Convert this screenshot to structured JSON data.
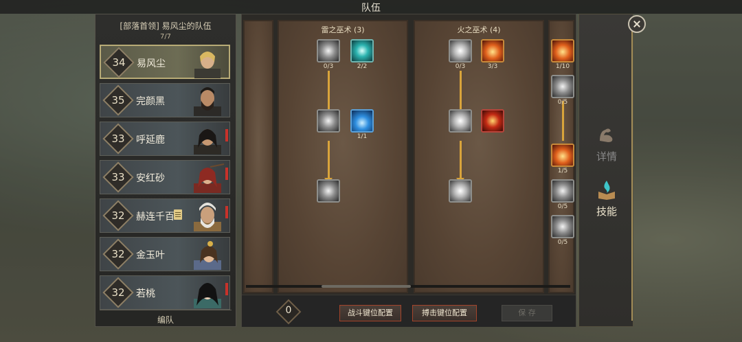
{
  "title": "队伍",
  "roster": {
    "title": "[部落首领] 易风尘的队伍",
    "count": "7/7",
    "members": [
      {
        "level": "34",
        "name": "易风尘"
      },
      {
        "level": "35",
        "name": "完颜黑"
      },
      {
        "level": "33",
        "name": "呼延鹿"
      },
      {
        "level": "33",
        "name": "安红砂"
      },
      {
        "level": "32",
        "name": "赫连千百"
      },
      {
        "level": "32",
        "name": "金玉叶"
      },
      {
        "level": "32",
        "name": "若桃"
      }
    ],
    "formation_label": "编队"
  },
  "skill_trees": {
    "thunder": {
      "label": "雷之巫术 (3)",
      "counts": [
        "0/3",
        "2/2",
        "1/1"
      ]
    },
    "fire": {
      "label": "火之巫术 (4)",
      "counts": [
        "0/3",
        "3/3"
      ]
    },
    "third": {
      "counts": [
        "1/10",
        "0/5",
        "1/5",
        "0/5",
        "0/5"
      ]
    }
  },
  "bottom": {
    "points": "0",
    "battle_key_config": "战斗键位配置",
    "capture_key_config": "搏击键位配置",
    "save": "保 存"
  },
  "tabs": {
    "details": "详情",
    "skills": "技能"
  },
  "colors": {
    "accent_gold": "#d9a43b",
    "button_border": "#a5442a",
    "alert_red": "#c8322a"
  }
}
